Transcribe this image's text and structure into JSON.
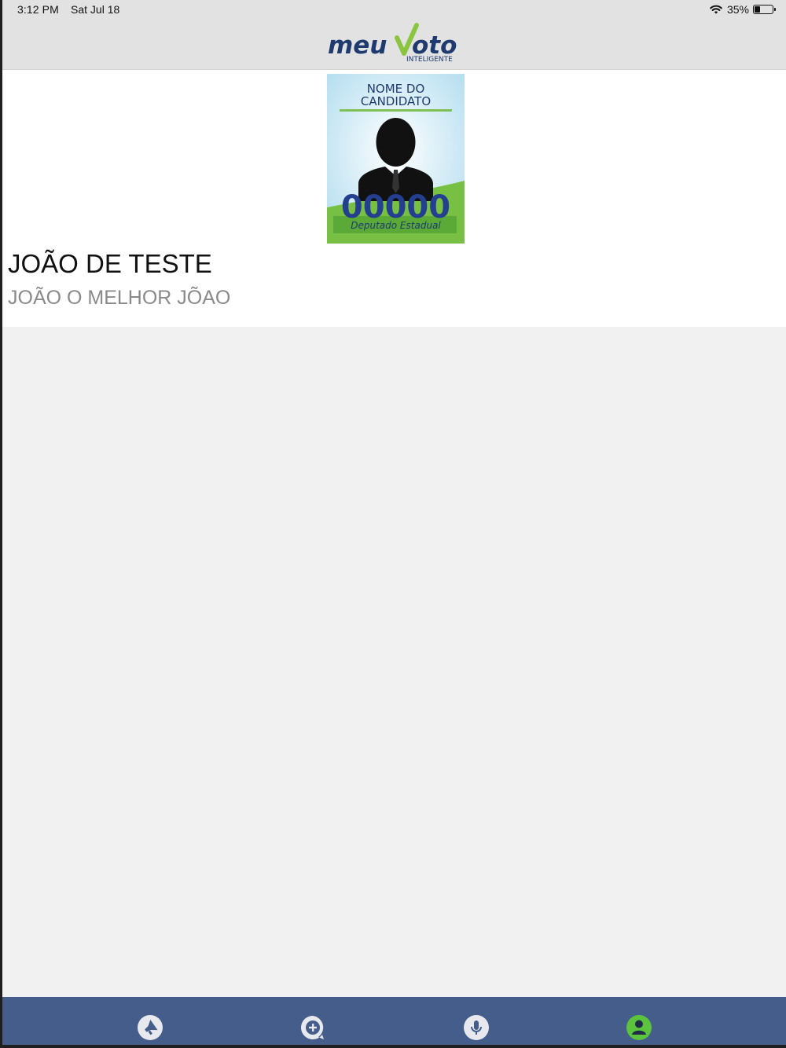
{
  "status_bar": {
    "time": "3:12 PM",
    "date": "Sat Jul 18",
    "battery": "35%",
    "battery_level": 0.35
  },
  "header": {
    "logo_word_1": "meu",
    "logo_word_2": "oto",
    "logo_tagline": "INTELIGENTE"
  },
  "poster": {
    "title_line_1": "NOME DO",
    "title_line_2": "CANDIDATO",
    "number": "00000",
    "office": "Deputado Estadual"
  },
  "candidate": {
    "name": "JOÃO DE TESTE",
    "slogan": "JOÃO O MELHOR JÕAO"
  },
  "tabs": [
    {
      "icon": "megaphone-icon",
      "active": false
    },
    {
      "icon": "chat-add-icon",
      "active": false
    },
    {
      "icon": "microphone-icon",
      "active": false
    },
    {
      "icon": "profile-icon",
      "active": true
    }
  ],
  "colors": {
    "header_bg": "#e2e2e2",
    "brand_navy": "#1f3a6e",
    "brand_green": "#8bc53f",
    "tabbar_bg": "#445d8a",
    "active_tab": "#5cc43c"
  }
}
